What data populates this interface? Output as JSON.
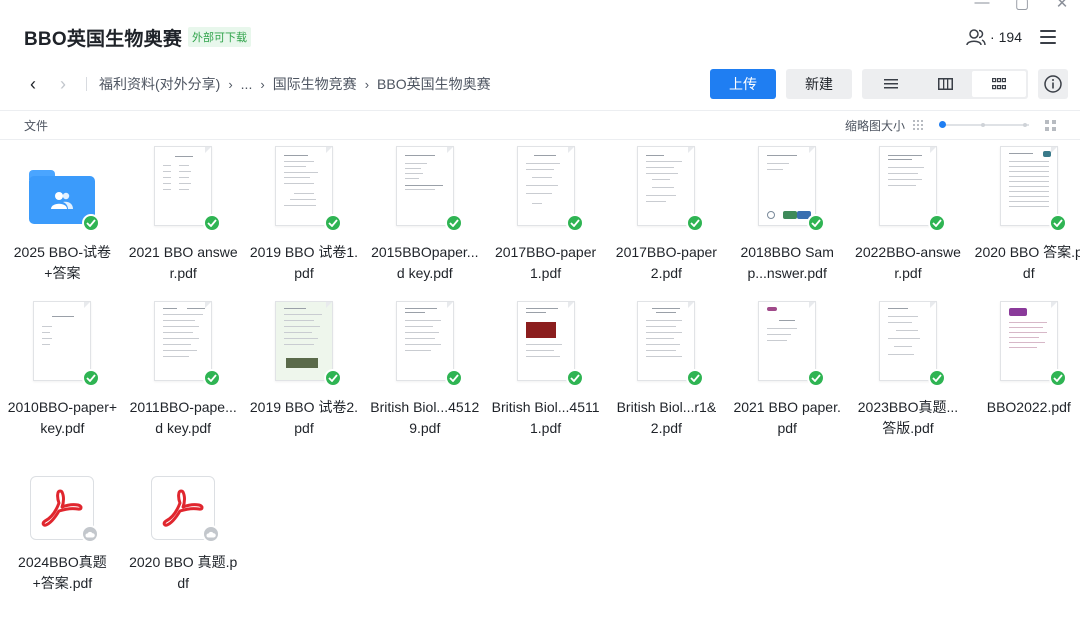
{
  "header": {
    "title": "BBO英国生物奥赛",
    "tag": "外部可下载",
    "member_count": "194"
  },
  "breadcrumb": [
    "福利资料(对外分享)",
    "...",
    "国际生物竞赛",
    "BBO英国生物奥赛"
  ],
  "toolbar": {
    "upload_label": "上传",
    "new_label": "新建"
  },
  "subheader": {
    "left_label": "文件",
    "thumb_size_label": "缩略图大小"
  },
  "colors": {
    "accent": "#1f7ef2",
    "sync_ok": "#2fb453",
    "folder": "#3b9bfb",
    "pdf_red": "#e0262e"
  },
  "files": [
    {
      "name": "2025 BBO-试卷+答案",
      "kind": "folder",
      "status": "synced"
    },
    {
      "name": "2021 BBO answer.pdf",
      "kind": "doc",
      "status": "synced"
    },
    {
      "name": "2019 BBO 试卷1.pdf",
      "kind": "doc",
      "status": "synced"
    },
    {
      "name": "2015BBOpaper...d key.pdf",
      "kind": "doc",
      "status": "synced"
    },
    {
      "name": "2017BBO-paper1.pdf",
      "kind": "doc",
      "status": "synced"
    },
    {
      "name": "2017BBO-paper2.pdf",
      "kind": "doc",
      "status": "synced"
    },
    {
      "name": "2018BBO Samp...nswer.pdf",
      "kind": "doc",
      "status": "synced"
    },
    {
      "name": "2022BBO-answer.pdf",
      "kind": "doc",
      "status": "synced"
    },
    {
      "name": "2020 BBO 答案.pdf",
      "kind": "doc",
      "status": "synced"
    },
    {
      "name": "2010BBO-paper+key.pdf",
      "kind": "doc",
      "status": "synced"
    },
    {
      "name": "2011BBO-pape...d key.pdf",
      "kind": "doc",
      "status": "synced"
    },
    {
      "name": "2019 BBO 试卷2.pdf",
      "kind": "doc",
      "status": "synced"
    },
    {
      "name": "British Biol...45129.pdf",
      "kind": "doc",
      "status": "synced"
    },
    {
      "name": "British Biol...45111.pdf",
      "kind": "doc",
      "status": "synced"
    },
    {
      "name": "British Biol...r1&2.pdf",
      "kind": "doc",
      "status": "synced"
    },
    {
      "name": "2021 BBO paper.pdf",
      "kind": "doc",
      "status": "synced"
    },
    {
      "name": "2023BBO真题...答版.pdf",
      "kind": "doc",
      "status": "synced"
    },
    {
      "name": "BBO2022.pdf",
      "kind": "doc",
      "status": "synced"
    },
    {
      "name": "2024BBO真题+答案.pdf",
      "kind": "pdf",
      "status": "cloud"
    },
    {
      "name": "2020 BBO 真题.pdf",
      "kind": "pdf",
      "status": "cloud"
    }
  ]
}
